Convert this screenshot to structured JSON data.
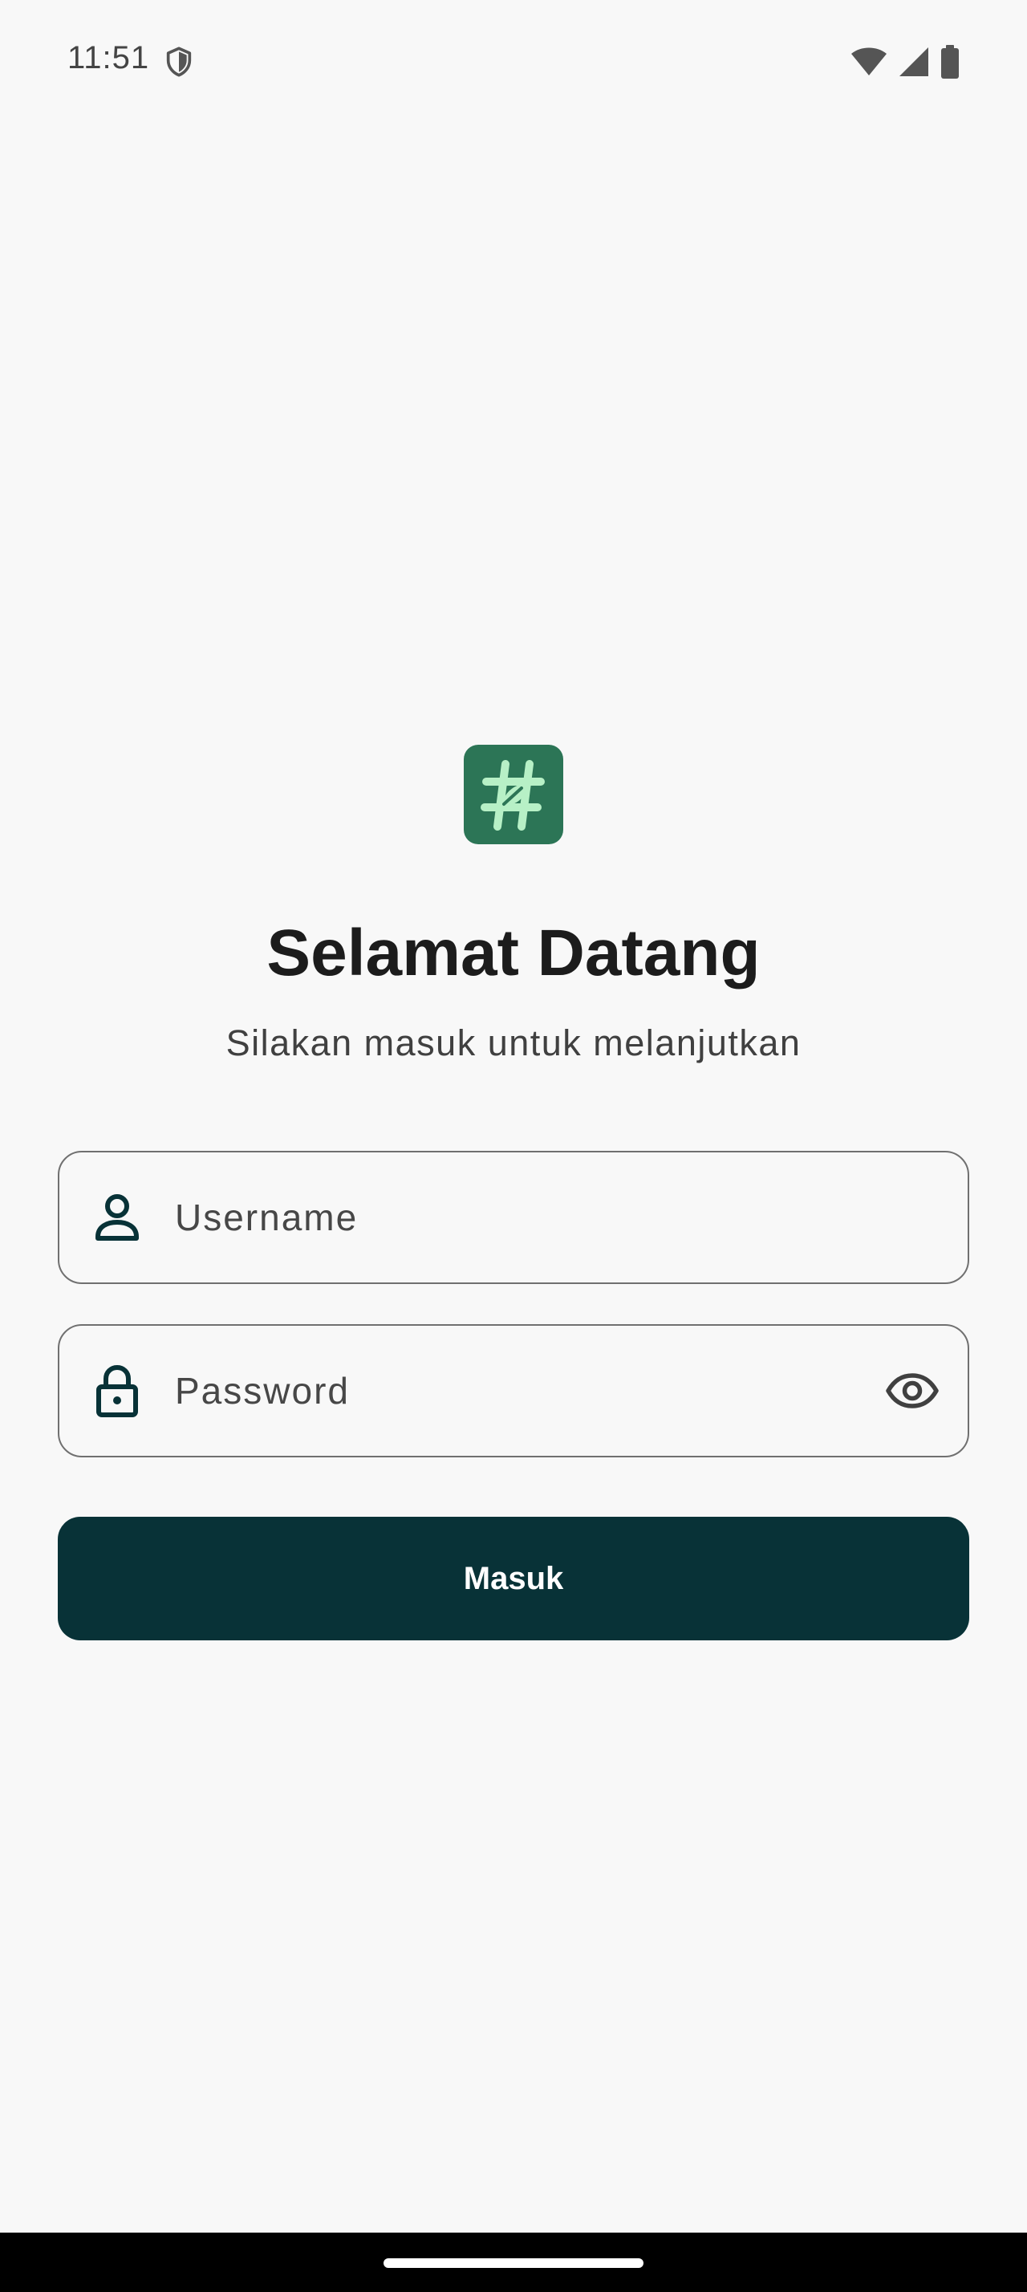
{
  "status_bar": {
    "time": "11:51",
    "icons": [
      "shield-icon",
      "wifi-icon",
      "signal-icon",
      "battery-icon"
    ]
  },
  "logo": {
    "icon": "hash-leaf-icon",
    "background_color": "#2c7556",
    "glyph_color": "#b7f0c6"
  },
  "login": {
    "title": "Selamat Datang",
    "subtitle": "Silakan masuk untuk melanjutkan",
    "username": {
      "icon": "person-icon",
      "placeholder": "Username",
      "value": ""
    },
    "password": {
      "icon": "lock-icon",
      "placeholder": "Password",
      "value": "",
      "toggle_icon": "eye-icon"
    },
    "submit_label": "Masuk"
  },
  "colors": {
    "background": "#f8f8f8",
    "primary_button": "#083237",
    "icon_dark": "#083237",
    "field_border": "#707070"
  }
}
